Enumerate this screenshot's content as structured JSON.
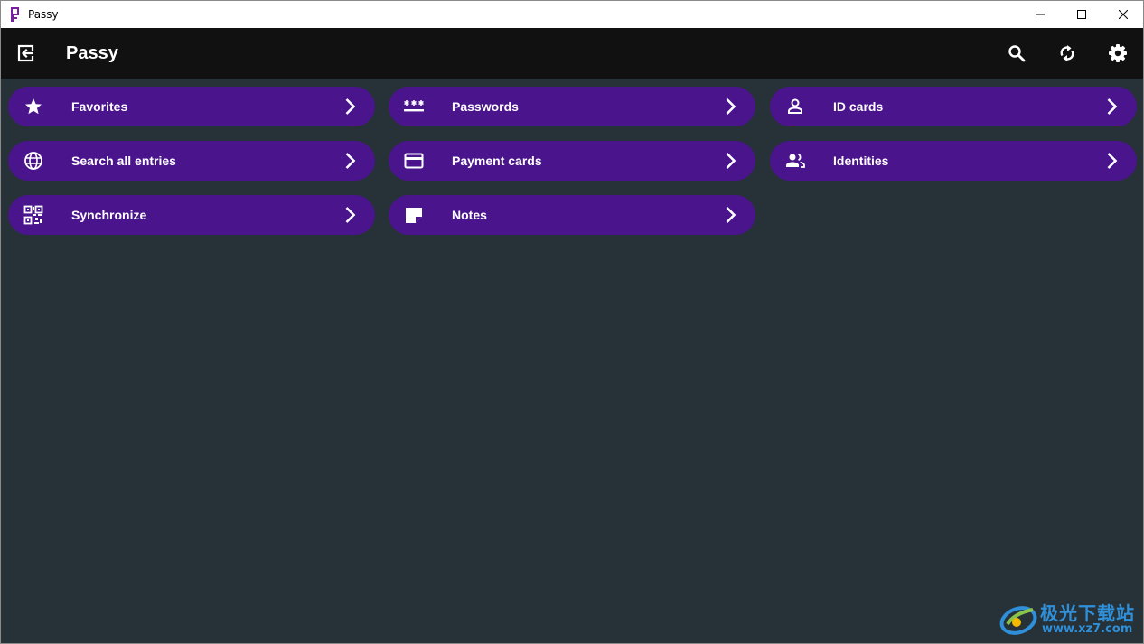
{
  "window": {
    "title": "Passy",
    "controls": {
      "minimize": "minimize-icon",
      "maximize": "maximize-icon",
      "close": "close-icon"
    }
  },
  "appbar": {
    "title": "Passy",
    "back_icon": "logout-icon",
    "actions": [
      "search-icon",
      "sync-icon",
      "settings-icon"
    ]
  },
  "tiles": [
    {
      "label": "Favorites",
      "icon": "star-icon"
    },
    {
      "label": "Passwords",
      "icon": "password-icon"
    },
    {
      "label": "ID cards",
      "icon": "person-icon"
    },
    {
      "label": "Search all entries",
      "icon": "globe-icon"
    },
    {
      "label": "Payment cards",
      "icon": "credit-card-icon"
    },
    {
      "label": "Identities",
      "icon": "people-icon"
    },
    {
      "label": "Synchronize",
      "icon": "qr-code-icon"
    },
    {
      "label": "Notes",
      "icon": "note-icon"
    }
  ],
  "watermark": {
    "name": "极光下载站",
    "url": "www.xz7.com"
  },
  "colors": {
    "background": "#263238",
    "appbar": "#111111",
    "tile": "#4a148c",
    "text": "#ffffff",
    "watermark": "#2f8fd8"
  }
}
